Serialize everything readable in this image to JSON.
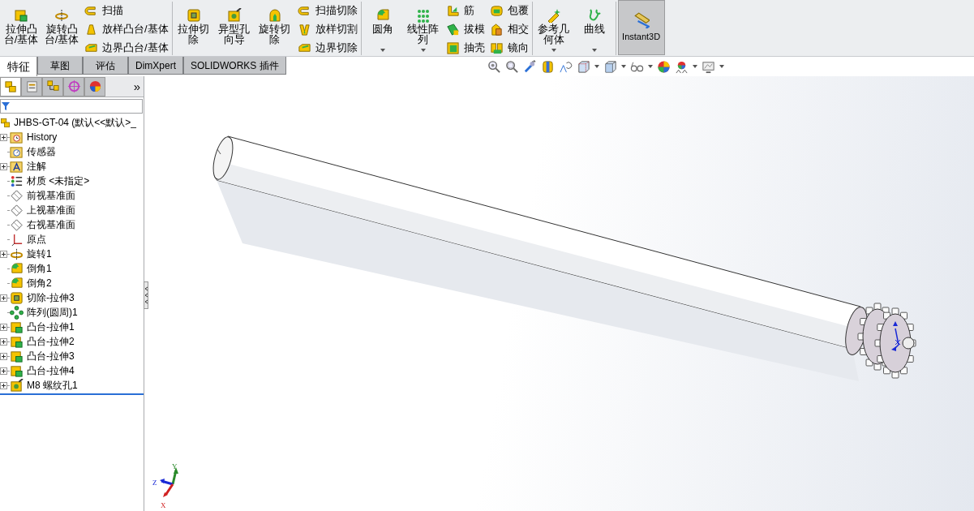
{
  "ribbon": {
    "groups": [
      {
        "large": [
          {
            "label": "拉伸凸台/基体",
            "kind": "extrude",
            "dropdown": false
          },
          {
            "label": "旋转凸台/基体",
            "kind": "revolve",
            "dropdown": false
          }
        ],
        "small_columns": [
          [
            {
              "label": "扫描",
              "kind": "sweep"
            },
            {
              "label": "放样凸台/基体",
              "kind": "loft"
            },
            {
              "label": "边界凸台/基体",
              "kind": "boundary"
            }
          ]
        ]
      },
      {
        "large": [
          {
            "label": "拉伸切除",
            "kind": "cut",
            "dropdown": false
          },
          {
            "label": "异型孔向导",
            "kind": "hole",
            "dropdown": false
          },
          {
            "label": "旋转切除",
            "kind": "revcut",
            "dropdown": false
          }
        ],
        "small_columns": [
          [
            {
              "label": "扫描切除",
              "kind": "sweep"
            },
            {
              "label": "放样切割",
              "kind": "loftcut"
            },
            {
              "label": "边界切除",
              "kind": "boundary"
            }
          ]
        ]
      },
      {
        "large": [
          {
            "label": "圆角",
            "kind": "fillet",
            "dropdown": true
          },
          {
            "label": "线性阵列",
            "kind": "pattern",
            "dropdown": true
          }
        ],
        "small_columns": [
          [
            {
              "label": "筋",
              "kind": "rib"
            },
            {
              "label": "拔模",
              "kind": "draft"
            },
            {
              "label": "抽壳",
              "kind": "shell"
            }
          ],
          [
            {
              "label": "包覆",
              "kind": "wrap"
            },
            {
              "label": "相交",
              "kind": "intersect"
            },
            {
              "label": "镜向",
              "kind": "mirror"
            }
          ]
        ]
      },
      {
        "large": [
          {
            "label": "参考几何体",
            "kind": "refgeom",
            "dropdown": true
          },
          {
            "label": "曲线",
            "kind": "curve",
            "dropdown": true
          }
        ]
      }
    ],
    "instant3d": {
      "label": "Instant3D",
      "selected": true
    }
  },
  "command_tabs": [
    {
      "label": "特征",
      "selected": true
    },
    {
      "label": "草图",
      "selected": false
    },
    {
      "label": "评估",
      "selected": false
    },
    {
      "label": "DimXpert",
      "selected": false
    },
    {
      "label": "SOLIDWORKS 插件",
      "selected": false
    }
  ],
  "panel_tabs": [
    {
      "kind": "tree",
      "selected": true
    },
    {
      "kind": "property",
      "selected": false
    },
    {
      "kind": "config",
      "selected": false
    },
    {
      "kind": "target",
      "selected": false
    },
    {
      "kind": "appearance",
      "selected": false
    }
  ],
  "panel_more": "»",
  "tree": {
    "root": "JHBS-GT-04 (默认<<默认>_",
    "items": [
      {
        "label": "History",
        "kind": "history",
        "expandable": true
      },
      {
        "label": "传感器",
        "kind": "sensor",
        "expandable": false
      },
      {
        "label": "注解",
        "kind": "annotation",
        "expandable": true
      },
      {
        "label": "材质 <未指定>",
        "kind": "material",
        "expandable": false
      },
      {
        "label": "前视基准面",
        "kind": "plane",
        "expandable": false
      },
      {
        "label": "上视基准面",
        "kind": "plane",
        "expandable": false
      },
      {
        "label": "右视基准面",
        "kind": "plane",
        "expandable": false
      },
      {
        "label": "原点",
        "kind": "origin",
        "expandable": false
      },
      {
        "label": "旋转1",
        "kind": "revolve",
        "expandable": true
      },
      {
        "label": "倒角1",
        "kind": "fillet",
        "expandable": false
      },
      {
        "label": "倒角2",
        "kind": "fillet",
        "expandable": false
      },
      {
        "label": "切除-拉伸3",
        "kind": "cut",
        "expandable": true
      },
      {
        "label": "阵列(圆周)1",
        "kind": "circpattern",
        "expandable": false
      },
      {
        "label": "凸台-拉伸1",
        "kind": "extrude",
        "expandable": true
      },
      {
        "label": "凸台-拉伸2",
        "kind": "extrude",
        "expandable": true
      },
      {
        "label": "凸台-拉伸3",
        "kind": "extrude",
        "expandable": true
      },
      {
        "label": "凸台-拉伸4",
        "kind": "extrude",
        "expandable": true
      },
      {
        "label": "M8 螺纹孔1",
        "kind": "hole",
        "expandable": true
      }
    ]
  },
  "triad": {
    "x": "X",
    "y": "Y",
    "z": "Z"
  }
}
